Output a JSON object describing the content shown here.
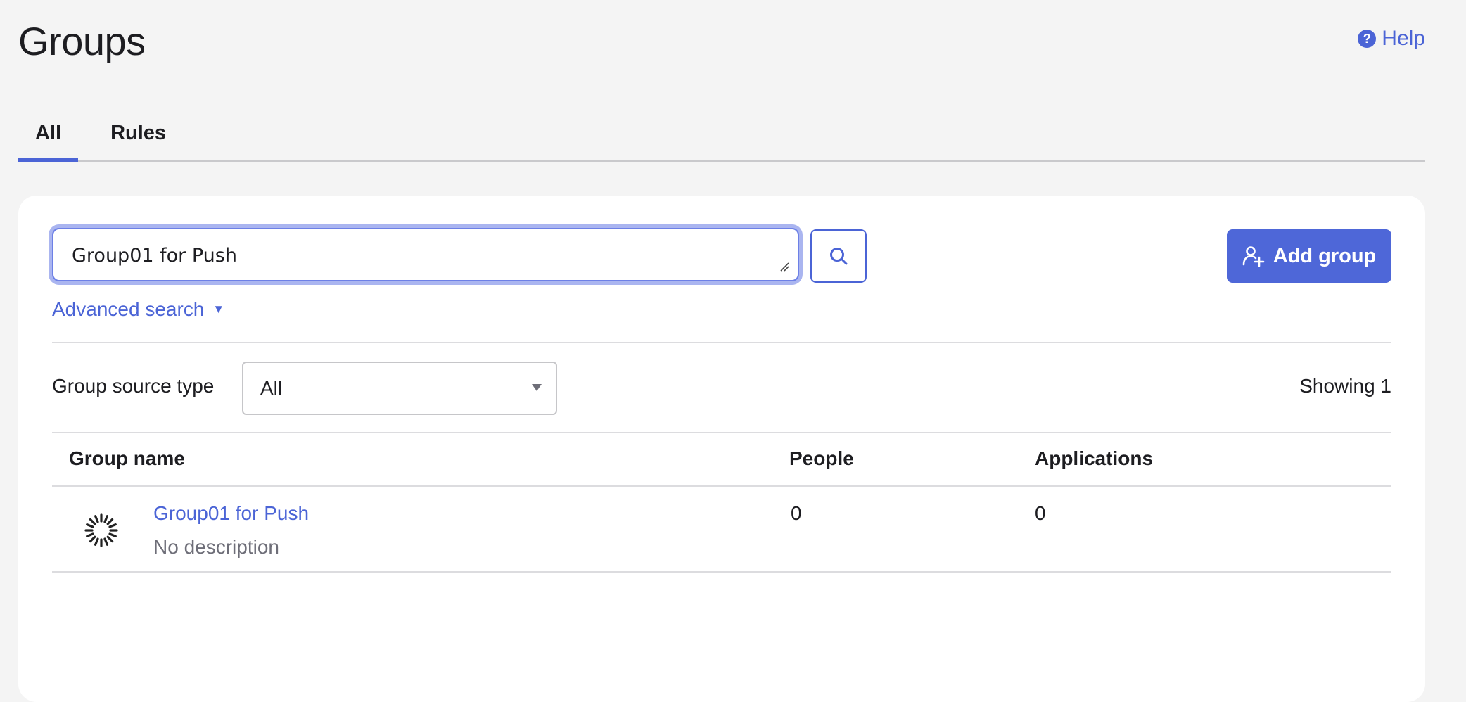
{
  "header": {
    "title": "Groups",
    "help_label": "Help"
  },
  "tabs": [
    {
      "label": "All",
      "active": true
    },
    {
      "label": "Rules",
      "active": false
    }
  ],
  "search": {
    "value": "Group01 for Push",
    "advanced_label": "Advanced search"
  },
  "actions": {
    "add_group_label": "Add group"
  },
  "filter": {
    "label": "Group source type",
    "selected": "All"
  },
  "results": {
    "showing_text": "Showing 1"
  },
  "table": {
    "columns": [
      "Group name",
      "People",
      "Applications"
    ],
    "rows": [
      {
        "name": "Group01 for Push",
        "description": "No description",
        "people": "0",
        "applications": "0"
      }
    ]
  },
  "colors": {
    "accent": "#4b64d6",
    "background": "#f4f4f4"
  }
}
